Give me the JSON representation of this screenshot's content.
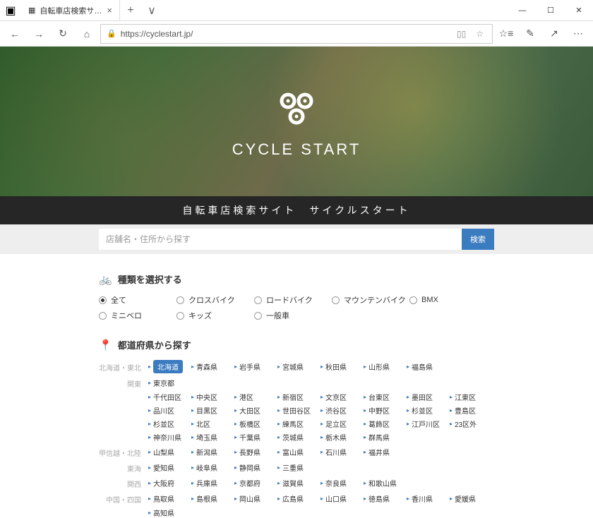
{
  "browser": {
    "tab_title": "自転車店検索サイト|サイ",
    "url": "https://cyclestart.jp/"
  },
  "hero": {
    "brand": "CYCLE START",
    "subtitle": "自転車店検索サイト　サイクルスタート"
  },
  "search": {
    "placeholder": "店舗名・住所から探す",
    "button": "検索"
  },
  "sections": {
    "type_title": "種類を選択する",
    "region_title": "都道府県から探す"
  },
  "types": [
    {
      "label": "全て",
      "checked": true
    },
    {
      "label": "クロスバイク",
      "checked": false
    },
    {
      "label": "ロードバイク",
      "checked": false
    },
    {
      "label": "マウンテンバイク",
      "checked": false
    },
    {
      "label": "BMX",
      "checked": false
    },
    {
      "label": "ミニベロ",
      "checked": false
    },
    {
      "label": "キッズ",
      "checked": false
    },
    {
      "label": "一般車",
      "checked": false
    }
  ],
  "regions": [
    {
      "label": "北海道・東北",
      "prefs": [
        {
          "name": "北海道",
          "active": true
        },
        {
          "name": "青森県"
        },
        {
          "name": "岩手県"
        },
        {
          "name": "宮城県"
        },
        {
          "name": "秋田県"
        },
        {
          "name": "山形県"
        },
        {
          "name": "福島県"
        }
      ]
    },
    {
      "label": "関東",
      "prefs": [
        {
          "name": "東京都"
        }
      ]
    },
    {
      "label": "",
      "prefs": [
        {
          "name": "千代田区"
        },
        {
          "name": "中央区"
        },
        {
          "name": "港区"
        },
        {
          "name": "新宿区"
        },
        {
          "name": "文京区"
        },
        {
          "name": "台東区"
        },
        {
          "name": "墨田区"
        },
        {
          "name": "江東区"
        }
      ]
    },
    {
      "label": "",
      "prefs": [
        {
          "name": "品川区"
        },
        {
          "name": "目黒区"
        },
        {
          "name": "大田区"
        },
        {
          "name": "世田谷区"
        },
        {
          "name": "渋谷区"
        },
        {
          "name": "中野区"
        },
        {
          "name": "杉並区"
        },
        {
          "name": "豊島区"
        }
      ]
    },
    {
      "label": "",
      "prefs": [
        {
          "name": "杉並区"
        },
        {
          "name": "北区"
        },
        {
          "name": "板橋区"
        },
        {
          "name": "練馬区"
        },
        {
          "name": "足立区"
        },
        {
          "name": "葛飾区"
        },
        {
          "name": "江戸川区"
        },
        {
          "name": "23区外"
        }
      ]
    },
    {
      "label": "",
      "prefs": [
        {
          "name": "神奈川県"
        },
        {
          "name": "埼玉県"
        },
        {
          "name": "千葉県"
        },
        {
          "name": "茨城県"
        },
        {
          "name": "栃木県"
        },
        {
          "name": "群馬県"
        }
      ]
    },
    {
      "label": "甲信越・北陸",
      "prefs": [
        {
          "name": "山梨県"
        },
        {
          "name": "新潟県"
        },
        {
          "name": "長野県"
        },
        {
          "name": "富山県"
        },
        {
          "name": "石川県"
        },
        {
          "name": "福井県"
        }
      ]
    },
    {
      "label": "東海",
      "prefs": [
        {
          "name": "愛知県"
        },
        {
          "name": "岐阜県"
        },
        {
          "name": "静岡県"
        },
        {
          "name": "三重県"
        }
      ]
    },
    {
      "label": "関西",
      "prefs": [
        {
          "name": "大阪府"
        },
        {
          "name": "兵庫県"
        },
        {
          "name": "京都府"
        },
        {
          "name": "滋賀県"
        },
        {
          "name": "奈良県"
        },
        {
          "name": "和歌山県"
        }
      ]
    },
    {
      "label": "中国・四国",
      "prefs": [
        {
          "name": "鳥取県"
        },
        {
          "name": "島根県"
        },
        {
          "name": "岡山県"
        },
        {
          "name": "広島県"
        },
        {
          "name": "山口県"
        },
        {
          "name": "徳島県"
        },
        {
          "name": "香川県"
        },
        {
          "name": "愛媛県"
        }
      ]
    },
    {
      "label": "",
      "prefs": [
        {
          "name": "高知県"
        }
      ]
    }
  ]
}
